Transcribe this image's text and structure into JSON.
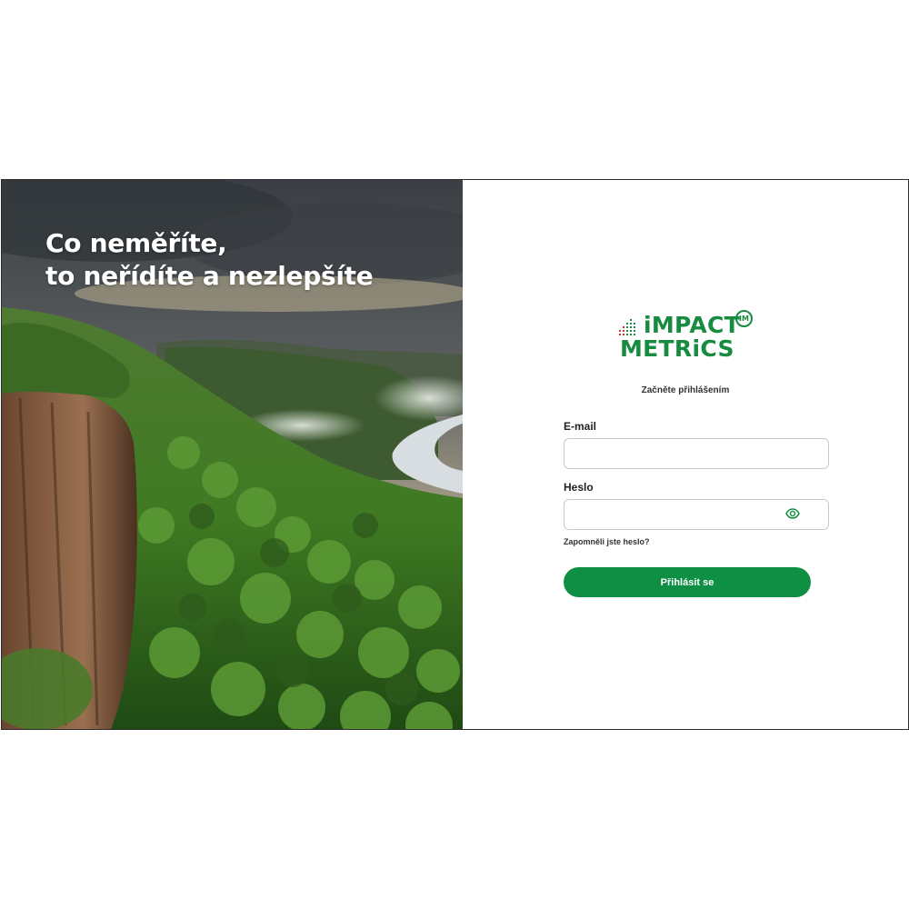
{
  "hero": {
    "headline_line1": "Co neměříte,",
    "headline_line2": "to neřídíte a nezlepšíte"
  },
  "logo": {
    "line1": "iMPACT",
    "line2": "METRiCS",
    "badge": "IM",
    "color": "#178b3f"
  },
  "login": {
    "subtitle": "Začněte přihlášením",
    "email_label": "E-mail",
    "email_value": "",
    "password_label": "Heslo",
    "password_value": "",
    "show_password_icon": "eye-icon",
    "forgot_link": "Zapomněli jste heslo?",
    "submit_label": "Přihlásit se",
    "accent_color": "#0f8f44"
  }
}
